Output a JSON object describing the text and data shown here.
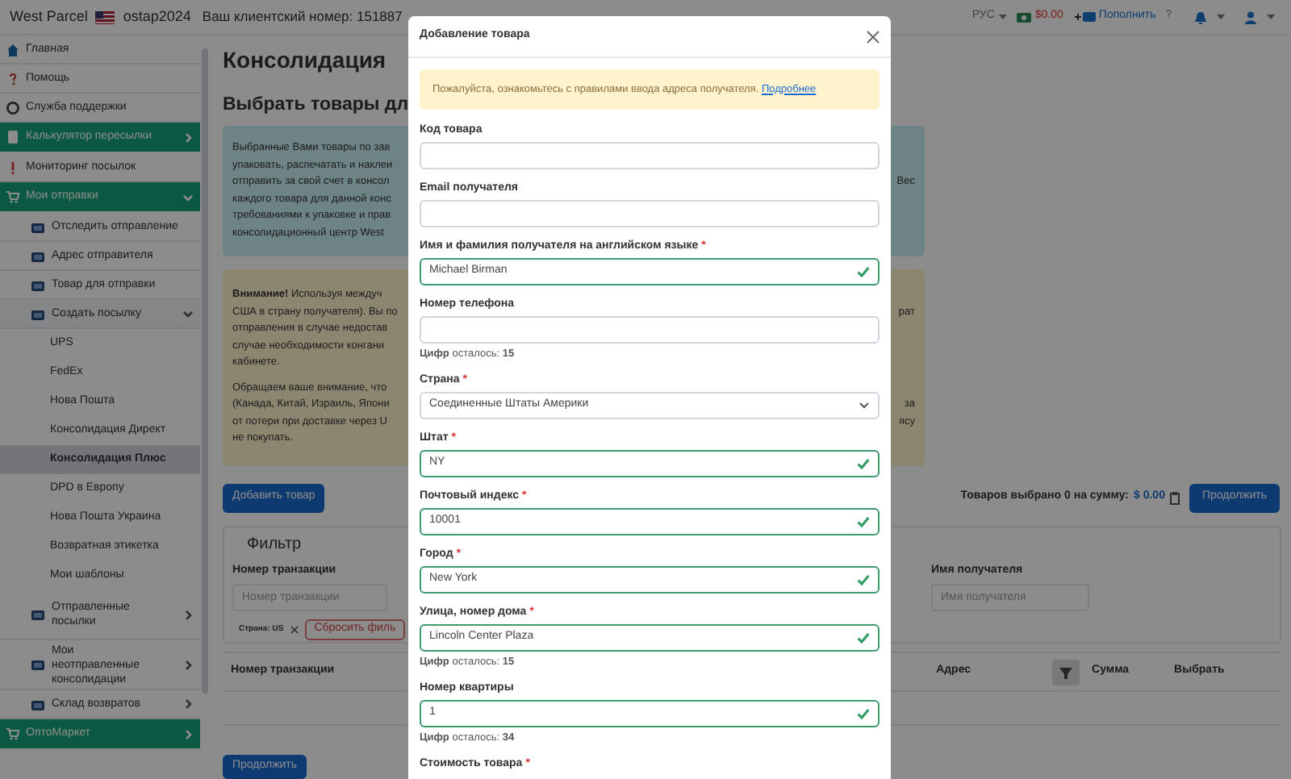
{
  "topbar": {
    "brand": "West Parcel",
    "username": "ostap2024",
    "client_number": "Ваш клиентский номер: 151887",
    "language": "РУС",
    "balance": "$0.00",
    "top_up": "Пополнить",
    "help": "?"
  },
  "sidebar": {
    "items": [
      {
        "label": "Главная",
        "kind": "link",
        "selected": false
      },
      {
        "label": "Помощь",
        "kind": "link",
        "selected": false
      },
      {
        "label": "Служба поддержки",
        "kind": "link",
        "selected": false
      },
      {
        "label": "Калькулятор пересылки",
        "kind": "section",
        "expanded": false,
        "selected": false
      },
      {
        "label": "Мониторинг посылок",
        "kind": "link",
        "selected": false
      },
      {
        "label": "Мои отправки",
        "kind": "section",
        "expanded": true,
        "selected": false,
        "children": [
          {
            "label": "Отследить отправление",
            "kind": "link",
            "selected": false
          },
          {
            "label": "Адрес отправителя",
            "kind": "link",
            "selected": false
          },
          {
            "label": "Товар для отправки",
            "kind": "link",
            "selected": false
          },
          {
            "label": "Создать посылку",
            "kind": "group",
            "expanded": true,
            "selected": false,
            "children": [
              {
                "label": "UPS",
                "selected": false
              },
              {
                "label": "FedEx",
                "selected": false
              },
              {
                "label": "Нова Пошта",
                "selected": false
              },
              {
                "label": "Консолидация Директ",
                "selected": false
              },
              {
                "label": "Консолидация Плюс",
                "selected": true
              },
              {
                "label": "DPD в Европу",
                "selected": false
              },
              {
                "label": "Нова Пошта Украина",
                "selected": false
              },
              {
                "label": "Возвратная этикетка",
                "selected": false
              },
              {
                "label": "Мои шаблоны",
                "selected": false
              }
            ]
          },
          {
            "label": "Отправленные посылки",
            "kind": "group",
            "expanded": false,
            "selected": false
          },
          {
            "label": "Мои неотправленные консолидации",
            "kind": "group",
            "expanded": false,
            "selected": false
          },
          {
            "label": "Склад возвратов",
            "kind": "group",
            "expanded": false,
            "selected": false
          }
        ]
      },
      {
        "label": "ОптоМаркет",
        "kind": "section",
        "expanded": false,
        "selected": false
      }
    ]
  },
  "main": {
    "title": "Консолидация",
    "subtitle": "Выбрать товары дл",
    "info_lines": [
      {
        "left": "Выбранные Вами товары по зав"
      },
      {
        "left": "упаковать, распечатать и наклеи"
      },
      {
        "left": "отправить за свой счет в консол",
        "right": "Вес"
      },
      {
        "left": "каждого товара для данной конс"
      },
      {
        "left": "требованиями к упаковке и прав"
      },
      {
        "left": "консолидационный центр West"
      }
    ],
    "warning_paragraphs": [
      [
        {
          "left": "**Внимание!** Используя междуч"
        },
        {
          "left": "США в страну получателя). Вы по",
          "right": "рат"
        },
        {
          "left": "отправления в случае недостав"
        },
        {
          "left": "случае необходимости конгани"
        },
        {
          "left": "кабинете."
        }
      ],
      [
        {
          "left": "Обращаем ваше внимание, что"
        },
        {
          "left": "(Канада, Китай, Израиль, Япони",
          "right": "за"
        },
        {
          "left": "от потери при доставке через U",
          "right": "ясу"
        },
        {
          "left": "не покупать."
        }
      ]
    ],
    "add_button": "Добавить товар",
    "selection_summary": "Товаров выбрано 0 на сумму:",
    "selection_amount": "$ 0.00",
    "continue_button_top": "Продолжить",
    "filter": {
      "title": "Фильтр",
      "transaction_label": "Номер транзакции",
      "transaction_placeholder": "Номер транзакции",
      "recipient_label": "Имя получателя",
      "recipient_placeholder": "Имя получателя",
      "country_tag": "Страна: US",
      "reset_button": "Сбросить филь"
    },
    "table": {
      "columns": [
        "Номер транзакции",
        "Адрес",
        "Сумма",
        "Выбрать"
      ]
    },
    "continue_button_bottom": "Продолжить"
  },
  "modal": {
    "title": "Добавление товара",
    "notice": "Пожалуйста, ознакомьтесь с правилами ввода адреса получателя.",
    "notice_link": "Подробнее",
    "fields": [
      {
        "kind": "input",
        "label": "Код товара",
        "valid": false
      },
      {
        "kind": "input",
        "label": "Email получателя",
        "valid": false
      },
      {
        "kind": "input",
        "label": "Имя и фамилия получателя на английском языке",
        "required_mark": "*",
        "value": "Michael Birman",
        "valid": true
      },
      {
        "kind": "input",
        "label": "Номер телефона",
        "valid": false,
        "hint": "**Цифр** осталось: **15**"
      },
      {
        "kind": "select",
        "label": "Страна",
        "required_mark": "*",
        "value": "Соединенные Штаты Америки",
        "valid": false
      },
      {
        "kind": "input",
        "label": "Штат",
        "required_mark": "*",
        "value": "NY",
        "valid": true
      },
      {
        "kind": "input",
        "label": "Почтовый индекс",
        "required_mark": "*",
        "value": "10001",
        "valid": true
      },
      {
        "kind": "input",
        "label": "Город",
        "required_mark": "*",
        "value": "New York",
        "valid": true
      },
      {
        "kind": "input",
        "label": "Улица, номер дома",
        "required_mark": "*",
        "value": "Lincoln Center Plaza",
        "valid": true,
        "hint": "**Цифр** осталось: **15**"
      },
      {
        "kind": "input",
        "label": "Номер квартиры",
        "value": "1",
        "valid": true,
        "hint": "**Цифр** осталось: **34**"
      },
      {
        "kind": "label",
        "label": "Стоимость товара",
        "required_mark": "*"
      }
    ]
  }
}
